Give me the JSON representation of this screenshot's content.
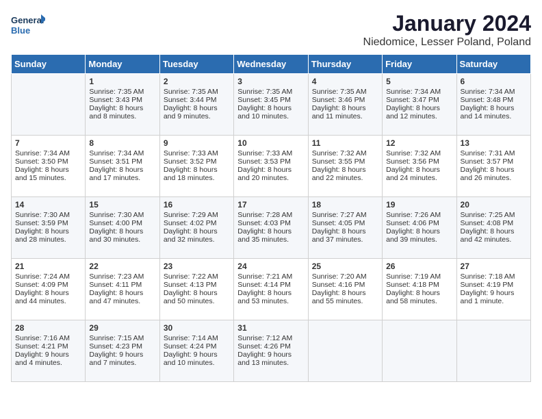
{
  "header": {
    "title": "January 2024",
    "subtitle": "Niedomice, Lesser Poland, Poland",
    "logo_general": "General",
    "logo_blue": "Blue"
  },
  "weekdays": [
    "Sunday",
    "Monday",
    "Tuesday",
    "Wednesday",
    "Thursday",
    "Friday",
    "Saturday"
  ],
  "weeks": [
    [
      {
        "day": "",
        "sunrise": "",
        "sunset": "",
        "daylight": ""
      },
      {
        "day": "1",
        "sunrise": "Sunrise: 7:35 AM",
        "sunset": "Sunset: 3:43 PM",
        "daylight": "Daylight: 8 hours and 8 minutes."
      },
      {
        "day": "2",
        "sunrise": "Sunrise: 7:35 AM",
        "sunset": "Sunset: 3:44 PM",
        "daylight": "Daylight: 8 hours and 9 minutes."
      },
      {
        "day": "3",
        "sunrise": "Sunrise: 7:35 AM",
        "sunset": "Sunset: 3:45 PM",
        "daylight": "Daylight: 8 hours and 10 minutes."
      },
      {
        "day": "4",
        "sunrise": "Sunrise: 7:35 AM",
        "sunset": "Sunset: 3:46 PM",
        "daylight": "Daylight: 8 hours and 11 minutes."
      },
      {
        "day": "5",
        "sunrise": "Sunrise: 7:34 AM",
        "sunset": "Sunset: 3:47 PM",
        "daylight": "Daylight: 8 hours and 12 minutes."
      },
      {
        "day": "6",
        "sunrise": "Sunrise: 7:34 AM",
        "sunset": "Sunset: 3:48 PM",
        "daylight": "Daylight: 8 hours and 14 minutes."
      }
    ],
    [
      {
        "day": "7",
        "sunrise": "Sunrise: 7:34 AM",
        "sunset": "Sunset: 3:50 PM",
        "daylight": "Daylight: 8 hours and 15 minutes."
      },
      {
        "day": "8",
        "sunrise": "Sunrise: 7:34 AM",
        "sunset": "Sunset: 3:51 PM",
        "daylight": "Daylight: 8 hours and 17 minutes."
      },
      {
        "day": "9",
        "sunrise": "Sunrise: 7:33 AM",
        "sunset": "Sunset: 3:52 PM",
        "daylight": "Daylight: 8 hours and 18 minutes."
      },
      {
        "day": "10",
        "sunrise": "Sunrise: 7:33 AM",
        "sunset": "Sunset: 3:53 PM",
        "daylight": "Daylight: 8 hours and 20 minutes."
      },
      {
        "day": "11",
        "sunrise": "Sunrise: 7:32 AM",
        "sunset": "Sunset: 3:55 PM",
        "daylight": "Daylight: 8 hours and 22 minutes."
      },
      {
        "day": "12",
        "sunrise": "Sunrise: 7:32 AM",
        "sunset": "Sunset: 3:56 PM",
        "daylight": "Daylight: 8 hours and 24 minutes."
      },
      {
        "day": "13",
        "sunrise": "Sunrise: 7:31 AM",
        "sunset": "Sunset: 3:57 PM",
        "daylight": "Daylight: 8 hours and 26 minutes."
      }
    ],
    [
      {
        "day": "14",
        "sunrise": "Sunrise: 7:30 AM",
        "sunset": "Sunset: 3:59 PM",
        "daylight": "Daylight: 8 hours and 28 minutes."
      },
      {
        "day": "15",
        "sunrise": "Sunrise: 7:30 AM",
        "sunset": "Sunset: 4:00 PM",
        "daylight": "Daylight: 8 hours and 30 minutes."
      },
      {
        "day": "16",
        "sunrise": "Sunrise: 7:29 AM",
        "sunset": "Sunset: 4:02 PM",
        "daylight": "Daylight: 8 hours and 32 minutes."
      },
      {
        "day": "17",
        "sunrise": "Sunrise: 7:28 AM",
        "sunset": "Sunset: 4:03 PM",
        "daylight": "Daylight: 8 hours and 35 minutes."
      },
      {
        "day": "18",
        "sunrise": "Sunrise: 7:27 AM",
        "sunset": "Sunset: 4:05 PM",
        "daylight": "Daylight: 8 hours and 37 minutes."
      },
      {
        "day": "19",
        "sunrise": "Sunrise: 7:26 AM",
        "sunset": "Sunset: 4:06 PM",
        "daylight": "Daylight: 8 hours and 39 minutes."
      },
      {
        "day": "20",
        "sunrise": "Sunrise: 7:25 AM",
        "sunset": "Sunset: 4:08 PM",
        "daylight": "Daylight: 8 hours and 42 minutes."
      }
    ],
    [
      {
        "day": "21",
        "sunrise": "Sunrise: 7:24 AM",
        "sunset": "Sunset: 4:09 PM",
        "daylight": "Daylight: 8 hours and 44 minutes."
      },
      {
        "day": "22",
        "sunrise": "Sunrise: 7:23 AM",
        "sunset": "Sunset: 4:11 PM",
        "daylight": "Daylight: 8 hours and 47 minutes."
      },
      {
        "day": "23",
        "sunrise": "Sunrise: 7:22 AM",
        "sunset": "Sunset: 4:13 PM",
        "daylight": "Daylight: 8 hours and 50 minutes."
      },
      {
        "day": "24",
        "sunrise": "Sunrise: 7:21 AM",
        "sunset": "Sunset: 4:14 PM",
        "daylight": "Daylight: 8 hours and 53 minutes."
      },
      {
        "day": "25",
        "sunrise": "Sunrise: 7:20 AM",
        "sunset": "Sunset: 4:16 PM",
        "daylight": "Daylight: 8 hours and 55 minutes."
      },
      {
        "day": "26",
        "sunrise": "Sunrise: 7:19 AM",
        "sunset": "Sunset: 4:18 PM",
        "daylight": "Daylight: 8 hours and 58 minutes."
      },
      {
        "day": "27",
        "sunrise": "Sunrise: 7:18 AM",
        "sunset": "Sunset: 4:19 PM",
        "daylight": "Daylight: 9 hours and 1 minute."
      }
    ],
    [
      {
        "day": "28",
        "sunrise": "Sunrise: 7:16 AM",
        "sunset": "Sunset: 4:21 PM",
        "daylight": "Daylight: 9 hours and 4 minutes."
      },
      {
        "day": "29",
        "sunrise": "Sunrise: 7:15 AM",
        "sunset": "Sunset: 4:23 PM",
        "daylight": "Daylight: 9 hours and 7 minutes."
      },
      {
        "day": "30",
        "sunrise": "Sunrise: 7:14 AM",
        "sunset": "Sunset: 4:24 PM",
        "daylight": "Daylight: 9 hours and 10 minutes."
      },
      {
        "day": "31",
        "sunrise": "Sunrise: 7:12 AM",
        "sunset": "Sunset: 4:26 PM",
        "daylight": "Daylight: 9 hours and 13 minutes."
      },
      {
        "day": "",
        "sunrise": "",
        "sunset": "",
        "daylight": ""
      },
      {
        "day": "",
        "sunrise": "",
        "sunset": "",
        "daylight": ""
      },
      {
        "day": "",
        "sunrise": "",
        "sunset": "",
        "daylight": ""
      }
    ]
  ]
}
